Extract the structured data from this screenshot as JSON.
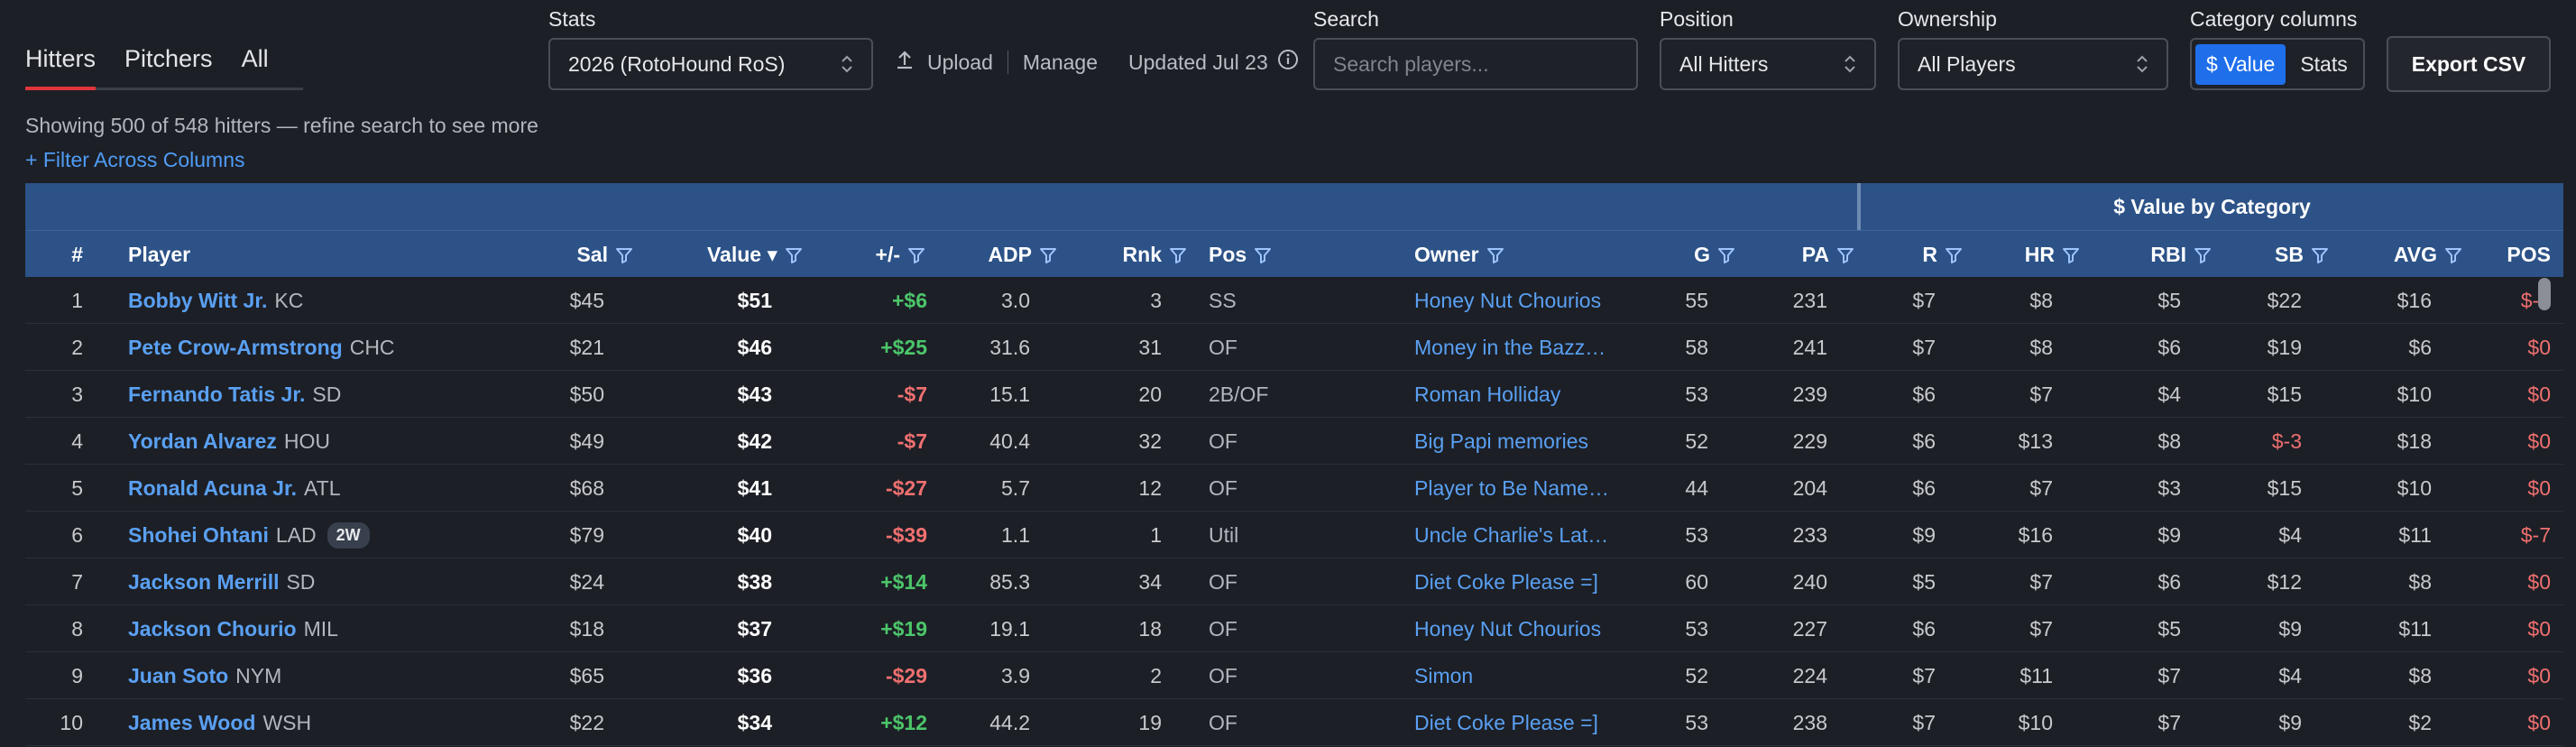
{
  "tabs": [
    {
      "label": "Hitters",
      "active": true
    },
    {
      "label": "Pitchers",
      "active": false
    },
    {
      "label": "All",
      "active": false
    }
  ],
  "stats": {
    "label": "Stats",
    "selected": "2026 (RotoHound RoS)"
  },
  "upload": {
    "upload_label": "Upload",
    "manage_label": "Manage",
    "updated_label": "Updated Jul 23"
  },
  "search": {
    "label": "Search",
    "placeholder": "Search players..."
  },
  "position": {
    "label": "Position",
    "selected": "All Hitters"
  },
  "ownership": {
    "label": "Ownership",
    "selected": "All Players"
  },
  "category_columns": {
    "label": "Category columns",
    "option_value": "$ Value",
    "option_stats": "Stats"
  },
  "export": {
    "label": "Export CSV"
  },
  "summary": {
    "showing": "Showing 500 of 548 hitters — refine search to see more",
    "filter_link": "+ Filter Across Columns"
  },
  "table": {
    "group_label": "$ Value by Category",
    "headers": {
      "num": "#",
      "player": "Player",
      "sal": "Sal",
      "value": "Value ▾",
      "diff": "+/-",
      "adp": "ADP",
      "rnk": "Rnk",
      "pos": "Pos",
      "owner": "Owner",
      "g": "G",
      "pa": "PA",
      "r": "R",
      "hr": "HR",
      "rbi": "RBI",
      "sb": "SB",
      "avg": "AVG",
      "posv": "POS"
    },
    "rows": [
      {
        "num": "1",
        "name": "Bobby Witt Jr.",
        "team": "KC",
        "badge": "",
        "sal": "$45",
        "value": "$51",
        "diff": "+$6",
        "adp": "3.0",
        "rnk": "3",
        "pos": "SS",
        "owner": "Honey Nut Chourios",
        "g": "55",
        "pa": "231",
        "r": "$7",
        "hr": "$8",
        "rbi": "$5",
        "sb": "$22",
        "avg": "$16",
        "posv": "$-7"
      },
      {
        "num": "2",
        "name": "Pete Crow-Armstrong",
        "team": "CHC",
        "badge": "",
        "sal": "$21",
        "value": "$46",
        "diff": "+$25",
        "adp": "31.6",
        "rnk": "31",
        "pos": "OF",
        "owner": "Money in the Bazz…",
        "g": "58",
        "pa": "241",
        "r": "$7",
        "hr": "$8",
        "rbi": "$6",
        "sb": "$19",
        "avg": "$6",
        "posv": "$0"
      },
      {
        "num": "3",
        "name": "Fernando Tatis Jr.",
        "team": "SD",
        "badge": "",
        "sal": "$50",
        "value": "$43",
        "diff": "-$7",
        "adp": "15.1",
        "rnk": "20",
        "pos": "2B/OF",
        "owner": "Roman Holliday",
        "g": "53",
        "pa": "239",
        "r": "$6",
        "hr": "$7",
        "rbi": "$4",
        "sb": "$15",
        "avg": "$10",
        "posv": "$0"
      },
      {
        "num": "4",
        "name": "Yordan Alvarez",
        "team": "HOU",
        "badge": "",
        "sal": "$49",
        "value": "$42",
        "diff": "-$7",
        "adp": "40.4",
        "rnk": "32",
        "pos": "OF",
        "owner": "Big Papi memories",
        "g": "52",
        "pa": "229",
        "r": "$6",
        "hr": "$13",
        "rbi": "$8",
        "sb": "$-3",
        "avg": "$18",
        "posv": "$0"
      },
      {
        "num": "5",
        "name": "Ronald Acuna Jr.",
        "team": "ATL",
        "badge": "",
        "sal": "$68",
        "value": "$41",
        "diff": "-$27",
        "adp": "5.7",
        "rnk": "12",
        "pos": "OF",
        "owner": "Player to Be Name…",
        "g": "44",
        "pa": "204",
        "r": "$6",
        "hr": "$7",
        "rbi": "$3",
        "sb": "$15",
        "avg": "$10",
        "posv": "$0"
      },
      {
        "num": "6",
        "name": "Shohei Ohtani",
        "team": "LAD",
        "badge": "2W",
        "sal": "$79",
        "value": "$40",
        "diff": "-$39",
        "adp": "1.1",
        "rnk": "1",
        "pos": "Util",
        "owner": "Uncle Charlie's Lat…",
        "g": "53",
        "pa": "233",
        "r": "$9",
        "hr": "$16",
        "rbi": "$9",
        "sb": "$4",
        "avg": "$11",
        "posv": "$-7"
      },
      {
        "num": "7",
        "name": "Jackson Merrill",
        "team": "SD",
        "badge": "",
        "sal": "$24",
        "value": "$38",
        "diff": "+$14",
        "adp": "85.3",
        "rnk": "34",
        "pos": "OF",
        "owner": "Diet Coke Please =]",
        "g": "60",
        "pa": "240",
        "r": "$5",
        "hr": "$7",
        "rbi": "$6",
        "sb": "$12",
        "avg": "$8",
        "posv": "$0"
      },
      {
        "num": "8",
        "name": "Jackson Chourio",
        "team": "MIL",
        "badge": "",
        "sal": "$18",
        "value": "$37",
        "diff": "+$19",
        "adp": "19.1",
        "rnk": "18",
        "pos": "OF",
        "owner": "Honey Nut Chourios",
        "g": "53",
        "pa": "227",
        "r": "$6",
        "hr": "$7",
        "rbi": "$5",
        "sb": "$9",
        "avg": "$11",
        "posv": "$0"
      },
      {
        "num": "9",
        "name": "Juan Soto",
        "team": "NYM",
        "badge": "",
        "sal": "$65",
        "value": "$36",
        "diff": "-$29",
        "adp": "3.9",
        "rnk": "2",
        "pos": "OF",
        "owner": "Simon",
        "g": "52",
        "pa": "224",
        "r": "$7",
        "hr": "$11",
        "rbi": "$7",
        "sb": "$4",
        "avg": "$8",
        "posv": "$0"
      },
      {
        "num": "10",
        "name": "James Wood",
        "team": "WSH",
        "badge": "",
        "sal": "$22",
        "value": "$34",
        "diff": "+$12",
        "adp": "44.2",
        "rnk": "19",
        "pos": "OF",
        "owner": "Diet Coke Please =]",
        "g": "53",
        "pa": "238",
        "r": "$7",
        "hr": "$10",
        "rbi": "$7",
        "sb": "$9",
        "avg": "$2",
        "posv": "$0"
      }
    ]
  },
  "colors": {
    "positive": "#4cc66a",
    "negative": "#f07070",
    "link": "#5aa0f2",
    "header_bg": "#2c5287",
    "accent_tab": "#e0353b"
  },
  "icons": {
    "filter": "filter-icon",
    "upload": "upload-icon",
    "info": "info-icon",
    "sort": "sort-desc-icon"
  }
}
